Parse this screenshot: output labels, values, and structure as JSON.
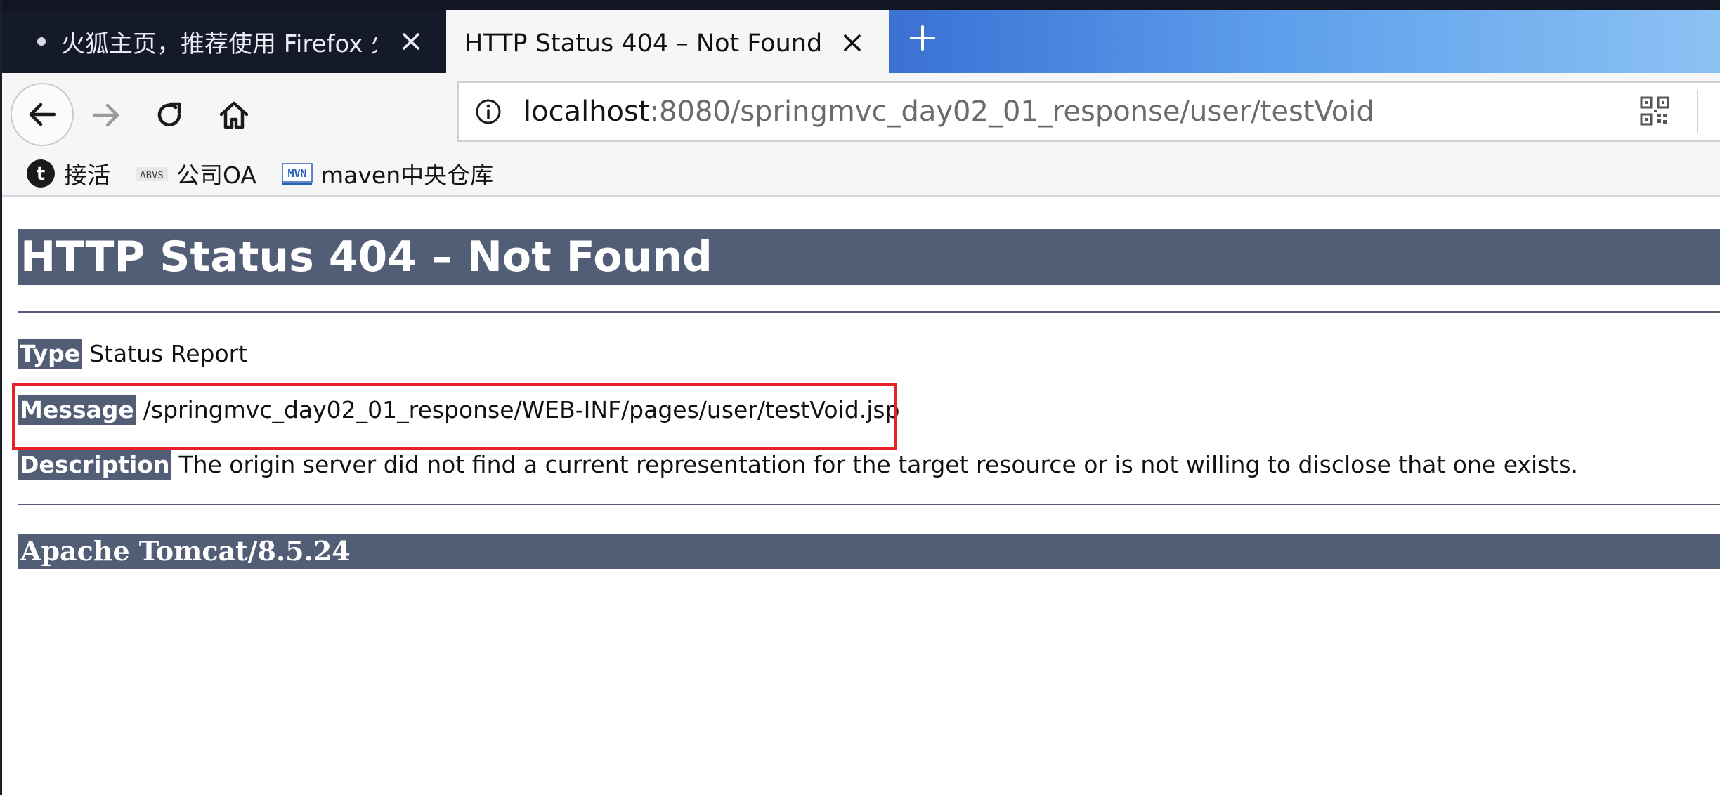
{
  "browser": {
    "tabs": [
      {
        "title": "火狐主页，推荐使用 Firefox 火",
        "active": false
      },
      {
        "title": "HTTP Status 404 – Not Found",
        "active": true
      }
    ],
    "url": {
      "host": "localhost",
      "rest": ":8080/springmvc_day02_01_response/user/testVoid"
    },
    "bookmarks": [
      {
        "label": "接活",
        "icon": "tumblr-icon"
      },
      {
        "label": "公司OA",
        "icon": "abvs-icon"
      },
      {
        "label": "maven中央仓库",
        "icon": "mvn-icon"
      }
    ]
  },
  "page": {
    "heading": "HTTP Status 404 – Not Found",
    "type_label": "Type",
    "type_value": "Status Report",
    "message_label": "Message",
    "message_value": "/springmvc_day02_01_response/WEB-INF/pages/user/testVoid.jsp",
    "description_label": "Description",
    "description_value": "The origin server did not find a current representation for the target resource or is not willing to disclose that one exists.",
    "server_info": "Apache Tomcat/8.5.24"
  },
  "annotation": {
    "color": "#e8202a"
  },
  "colors": {
    "tomcat_header": "#525d76",
    "tab_dark": "#141a2a"
  }
}
